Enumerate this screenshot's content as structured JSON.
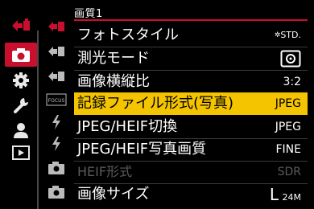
{
  "menu": {
    "title": "画質1"
  },
  "categories": [
    {
      "name": "photo-arrow",
      "active": false
    },
    {
      "name": "camera",
      "active": true
    },
    {
      "name": "gear",
      "active": false
    },
    {
      "name": "wrench",
      "active": false
    },
    {
      "name": "person",
      "active": false
    },
    {
      "name": "playback",
      "active": false
    }
  ],
  "sub_tabs": [
    "photo-arrow-1",
    "photo-arrow-2",
    "photo-arrow-3",
    "focus",
    "flash-1",
    "flash-2",
    "camera-small-1",
    "camera-small-2"
  ],
  "focus_tab_label": "FOCUS",
  "rows": [
    {
      "label": "フォトスタイル",
      "value": "STD.",
      "value_icon": "photo-style"
    },
    {
      "label": "測光モード",
      "value": "",
      "value_icon": "metering"
    },
    {
      "label": "画像横縦比",
      "value": "3:2"
    },
    {
      "label": "記録ファイル形式(写真)",
      "value": "JPEG",
      "selected": true
    },
    {
      "label": "JPEG/HEIF切換",
      "value": "JPEG"
    },
    {
      "label": "JPEG/HEIF写真画質",
      "value": "FINE"
    },
    {
      "label": "HEIF形式",
      "value": "SDR",
      "disabled": true
    },
    {
      "label": "画像サイズ",
      "value_big": "L",
      "value_small": "24M"
    }
  ]
}
